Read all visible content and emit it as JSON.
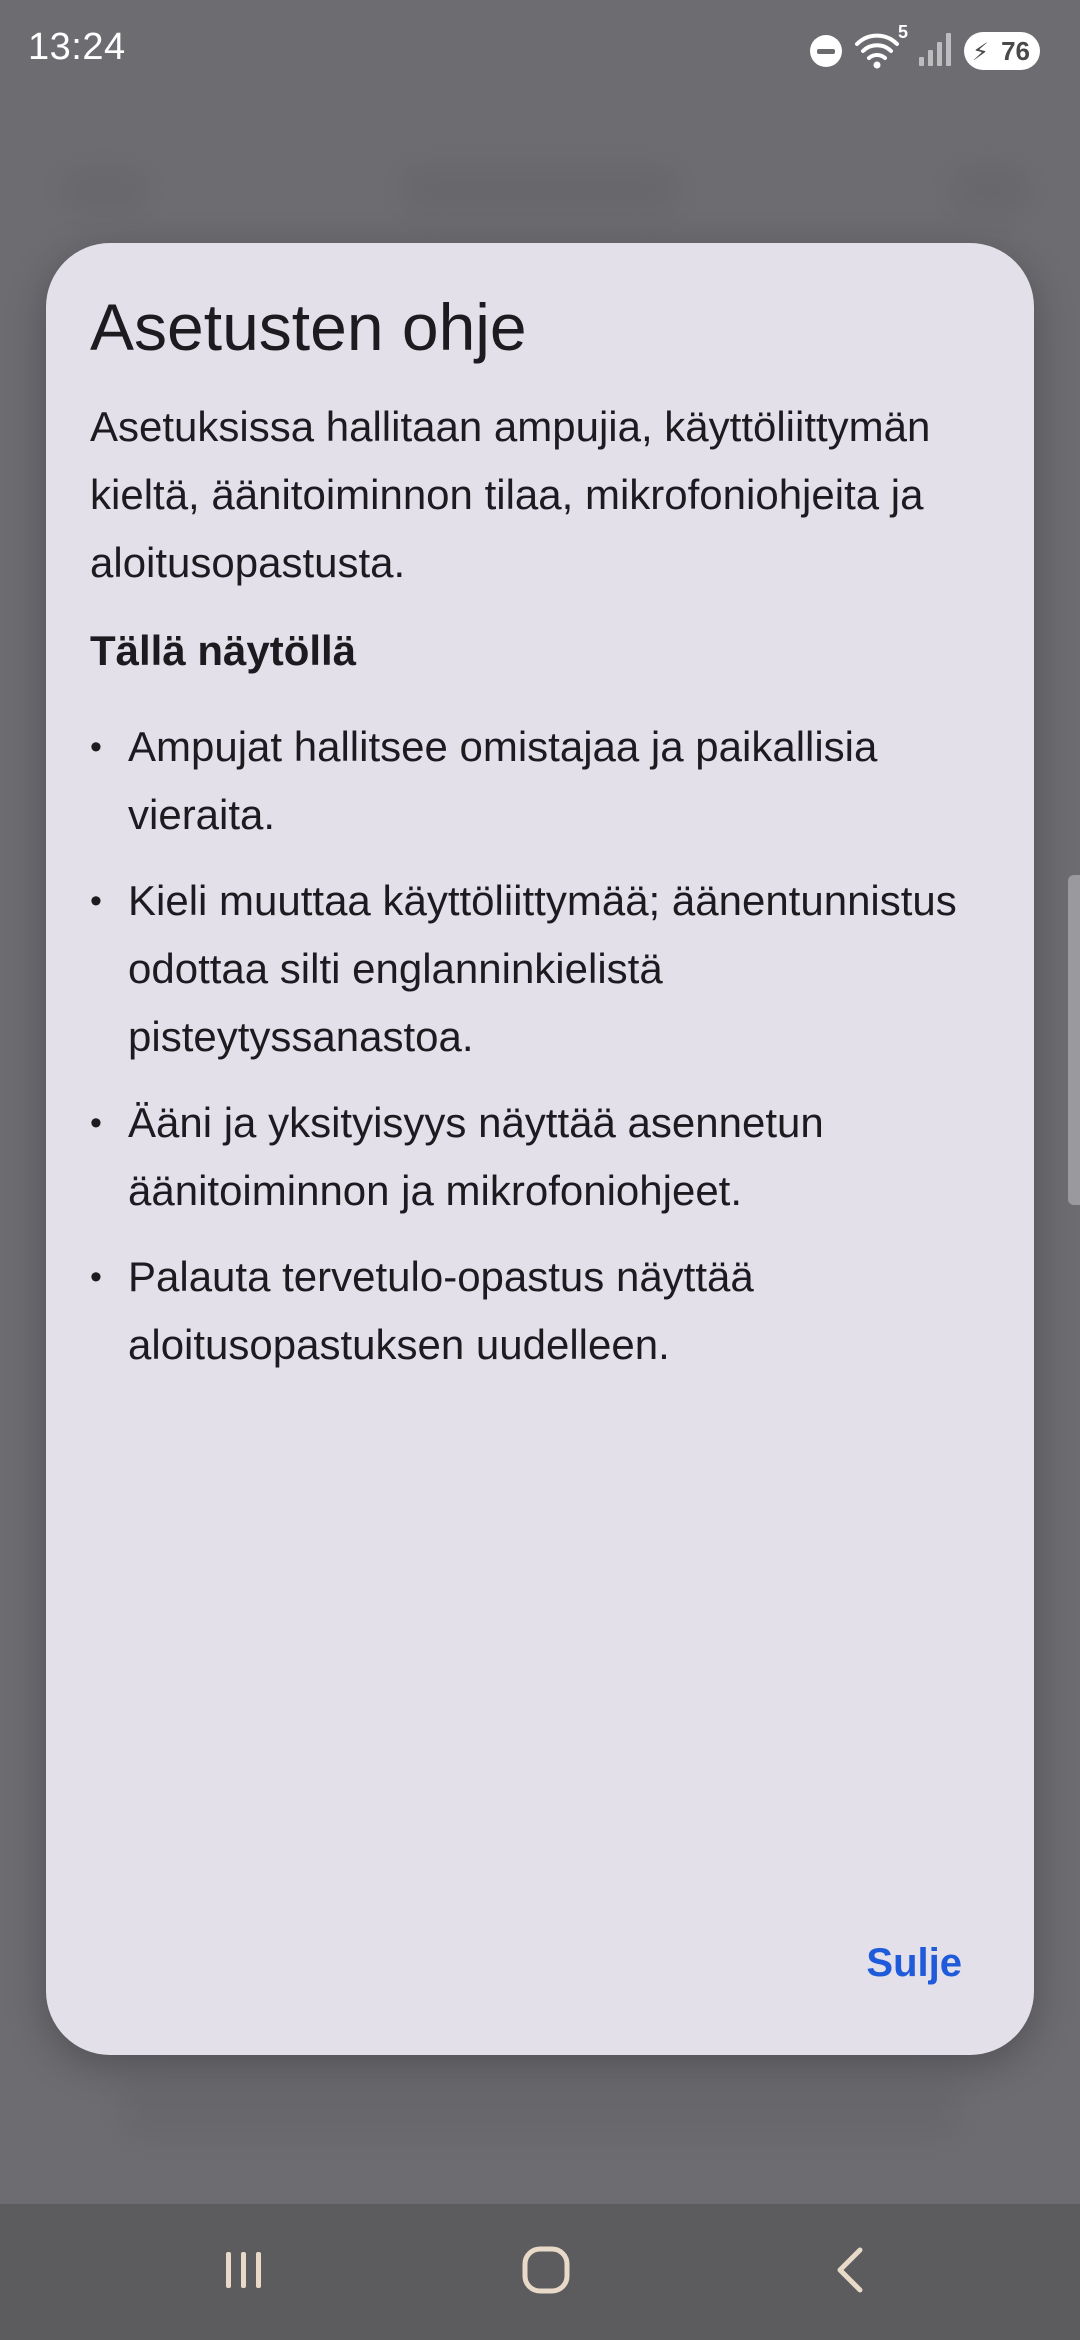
{
  "status_bar": {
    "time": "13:24",
    "wifi_label": "5",
    "battery_percent": "76",
    "icons": [
      "do-not-disturb-icon",
      "wifi-icon",
      "signal-icon",
      "battery-charging-icon"
    ]
  },
  "dialog": {
    "title": "Asetusten ohje",
    "intro": "Asetuksissa hallitaan ampujia, käyttöliittymän kieltä, äänitoiminnon tilaa, mikrofoniohjeita ja aloitusopastusta.",
    "subheading": "Tällä näytöllä",
    "items": [
      "Ampujat hallitsee omistajaa ja paikallisia vieraita.",
      "Kieli muuttaa käyttöliittymää; äänentunnistus odottaa silti englanninkielistä pisteytyssanastoa.",
      "Ääni ja yksityisyys näyttää asennetun äänitoiminnon ja mikrofoniohjeet.",
      "Palauta tervetulo-opastus näyttää aloitusopastuksen uudelleen."
    ],
    "close_label": "Sulje"
  },
  "nav_bar": {
    "buttons": [
      "recent-apps-icon",
      "home-icon",
      "back-icon"
    ]
  },
  "colors": {
    "dialog_background": "#e3e0e9",
    "scrim": "#6b6b6d",
    "accent": "#1e5ad9",
    "text": "#1d1b20"
  }
}
